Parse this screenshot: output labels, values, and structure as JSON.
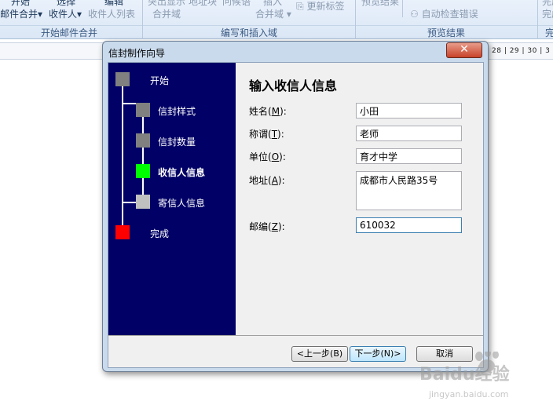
{
  "ribbon": {
    "items": [
      {
        "text": "邮件合并",
        "dim": false,
        "caret": true
      },
      {
        "text": "收件人",
        "dim": false,
        "caret": true
      },
      {
        "text": "收件人列表",
        "dim": true,
        "caret": false
      },
      {
        "text": "合并域",
        "dim": true,
        "caret": false
      },
      {
        "text": "合并域",
        "dim": true,
        "caret": true
      },
      {
        "text": "更新标签",
        "dim": true,
        "caret": false
      },
      {
        "text": "自动检查错误",
        "dim": true,
        "caret": false
      }
    ],
    "partial_top": [
      "开始",
      "选择",
      "编辑",
      "突出显示",
      "地址块",
      "问候语",
      "插入",
      "预览结果",
      "完成"
    ],
    "groups": [
      "开始邮件合并",
      "编写和插入域",
      "预览结果",
      "完"
    ]
  },
  "ruler": {
    "numbers": "28 | 29 | 30 | 3"
  },
  "dialog": {
    "title": "信封制作向导",
    "close_symbol": "✕",
    "steps": [
      {
        "label": "开始",
        "color": "#808080",
        "active": false
      },
      {
        "label": "信封样式",
        "color": "#808080",
        "active": false
      },
      {
        "label": "信封数量",
        "color": "#808080",
        "active": false
      },
      {
        "label": "收信人信息",
        "color": "#00ff00",
        "active": true
      },
      {
        "label": "寄信人信息",
        "color": "#c0c0c0",
        "active": false
      },
      {
        "label": "完成",
        "color": "#ff0000",
        "active": false
      }
    ],
    "heading": "输入收信人信息",
    "fields": {
      "name": {
        "label": "姓名",
        "key": "M",
        "value": "小田"
      },
      "title": {
        "label": "称谓",
        "key": "T",
        "value": "老师"
      },
      "org": {
        "label": "单位",
        "key": "O",
        "value": "育才中学"
      },
      "address": {
        "label": "地址",
        "key": "A",
        "value": "成都市人民路35号"
      },
      "zip": {
        "label": "邮编",
        "key": "Z",
        "value": "610032"
      }
    },
    "buttons": {
      "prev": "<上一步(B)",
      "next": "下一步(N)>",
      "cancel": "取消"
    }
  },
  "watermark": {
    "brand": "Baidu经验",
    "url": "jingyan.baidu.com"
  }
}
